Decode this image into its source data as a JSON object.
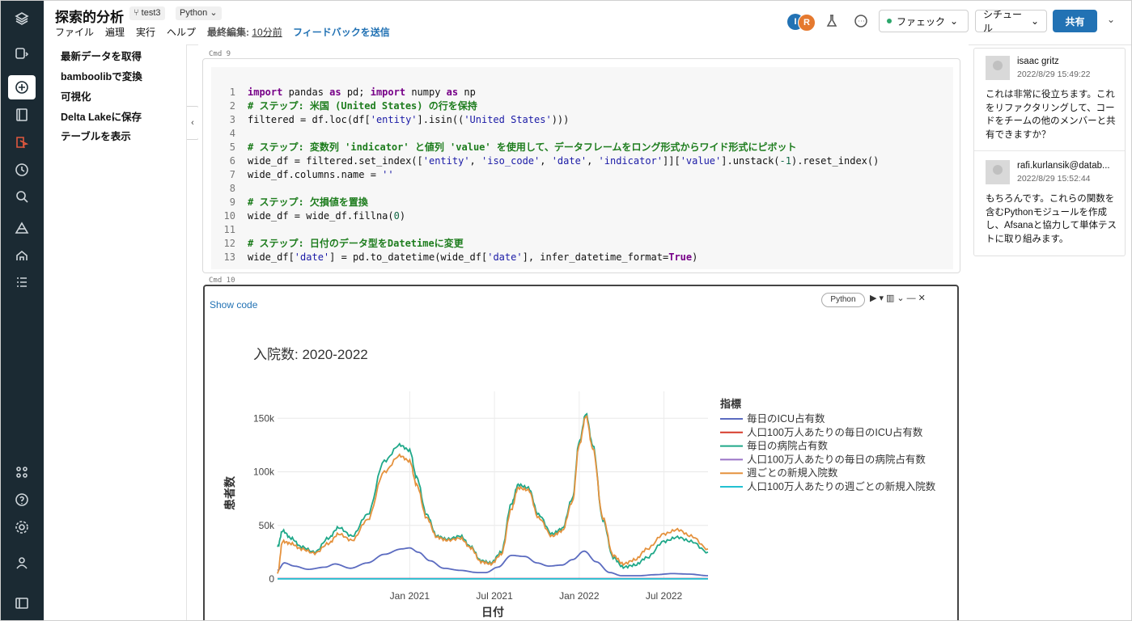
{
  "header": {
    "title": "探索的分析",
    "repo_chip": "test3",
    "lang_chip": "Python",
    "menu": [
      "ファイル",
      "遍理",
      "実行",
      "ヘルプ"
    ],
    "edited_label": "最終編集:",
    "edited_value": "10分前",
    "feedback": "フィードバックを送信",
    "avatar1": "I",
    "avatar2": "R",
    "compute_btn": "ファェック",
    "schedule_btn": "シチュール",
    "share_btn": "共有"
  },
  "toc": [
    "最新データを取得",
    "bamboolibで変換",
    "可視化",
    "Delta Lakeに保存",
    "テーブルを表示"
  ],
  "cells": {
    "cmd9": "Cmd 9",
    "cmd10": "Cmd 10",
    "show_code": "Show code",
    "py_chip": "Python"
  },
  "code_lines": [
    "import pandas as pd; import numpy as np",
    "# ステップ: 米国 (United States) の行を保持",
    "filtered = df.loc(df['entity'].isin(('United States')))",
    "",
    "# ステップ: 変数列 'indicator' と値列 'value' を使用して、データフレームをロング形式からワイド形式にピボット",
    "wide_df = filtered.set_index(['entity', 'iso_code', 'date', 'indicator']]['value'].unstack(-1).reset_index()",
    "wide_df.columns.name = ''",
    "",
    "# ステップ: 欠損値を置換",
    "wide_df = wide_df.fillna(0)",
    "",
    "# ステップ: 日付のデータ型をDatetimeに変更",
    "wide_df['date'] = pd.to_datetime(wide_df['date'], infer_datetime_format=True)"
  ],
  "comments": [
    {
      "name": "isaac gritz",
      "time": "2022/8/29 15:49:22",
      "body": "これは非常に役立ちます。これをリファクタリングして、コードをチームの他のメンバーと共有できますか？"
    },
    {
      "name": "rafi.kurlansik@datab...",
      "time": "2022/8/29 15:52:44",
      "body": "もちろんです。これらの関数を含むPythonモジュールを作成し、Afsanaと協力して単体テストに取り組みます。"
    }
  ],
  "chart_data": {
    "type": "line",
    "title": "入院数: 2020-2022",
    "xlabel": "日付",
    "ylabel": "患者数",
    "ylim": [
      0,
      160000
    ],
    "yticks": [
      {
        "v": 0,
        "label": "0"
      },
      {
        "v": 50000,
        "label": "50k"
      },
      {
        "v": 100000,
        "label": "100k"
      },
      {
        "v": 150000,
        "label": "150k"
      }
    ],
    "xticks": [
      {
        "v": 2021.0,
        "label": "Jan 2021"
      },
      {
        "v": 2021.5,
        "label": "Jul 2021"
      },
      {
        "v": 2022.0,
        "label": "Jan 2022"
      },
      {
        "v": 2022.5,
        "label": "Jul 2022"
      }
    ],
    "xlim": [
      2020.22,
      2022.76
    ],
    "legend_title": "指標",
    "legend_position": "right",
    "series": [
      {
        "name": "毎日のICU占有数",
        "color": "#5b6bc0",
        "x": [
          2020.22,
          2020.26,
          2020.32,
          2020.4,
          2020.5,
          2020.56,
          2020.65,
          2020.75,
          2020.85,
          2020.95,
          2021.0,
          2021.05,
          2021.12,
          2021.2,
          2021.3,
          2021.4,
          2021.45,
          2021.52,
          2021.6,
          2021.68,
          2021.75,
          2021.82,
          2021.9,
          2021.96,
          2022.03,
          2022.1,
          2022.18,
          2022.25,
          2022.35,
          2022.45,
          2022.55,
          2022.65,
          2022.76
        ],
        "values": [
          8000,
          15000,
          12000,
          9000,
          11000,
          14000,
          10000,
          15000,
          23000,
          28000,
          29000,
          25000,
          17000,
          10000,
          8000,
          6000,
          6000,
          11000,
          22000,
          21000,
          15000,
          12000,
          13000,
          18000,
          26000,
          16000,
          6000,
          3000,
          3000,
          4000,
          5000,
          4500,
          3000
        ]
      },
      {
        "name": "人口100万人あたりの毎日のICU占有数",
        "color": "#d63a2a",
        "x": [
          2020.22,
          2022.76
        ],
        "values": [
          300,
          300
        ]
      },
      {
        "name": "毎日の病院占有数",
        "color": "#1fa889",
        "x": [
          2020.22,
          2020.25,
          2020.3,
          2020.36,
          2020.44,
          2020.52,
          2020.58,
          2020.66,
          2020.75,
          2020.85,
          2020.94,
          2021.0,
          2021.04,
          2021.1,
          2021.16,
          2021.22,
          2021.3,
          2021.36,
          2021.42,
          2021.48,
          2021.54,
          2021.6,
          2021.64,
          2021.7,
          2021.76,
          2021.84,
          2021.9,
          2021.96,
          2022.0,
          2022.04,
          2022.08,
          2022.14,
          2022.2,
          2022.26,
          2022.33,
          2022.4,
          2022.5,
          2022.58,
          2022.66,
          2022.76
        ],
        "values": [
          30000,
          45000,
          38000,
          30000,
          25000,
          38000,
          48000,
          40000,
          60000,
          110000,
          125000,
          120000,
          95000,
          60000,
          40000,
          37000,
          40000,
          30000,
          17000,
          15000,
          25000,
          70000,
          88000,
          85000,
          60000,
          42000,
          47000,
          75000,
          128000,
          154000,
          125000,
          55000,
          20000,
          11000,
          13000,
          20000,
          35000,
          39000,
          35000,
          25000
        ]
      },
      {
        "name": "人口100万人あたりの毎日の病院占有数",
        "color": "#9a73c6",
        "x": [
          2020.22,
          2022.76
        ],
        "values": [
          200,
          200
        ]
      },
      {
        "name": "週ごとの新規入院数",
        "color": "#e5923e",
        "x": [
          2020.22,
          2020.25,
          2020.3,
          2020.36,
          2020.44,
          2020.52,
          2020.58,
          2020.66,
          2020.75,
          2020.85,
          2020.94,
          2021.0,
          2021.04,
          2021.1,
          2021.16,
          2021.22,
          2021.3,
          2021.36,
          2021.42,
          2021.48,
          2021.54,
          2021.6,
          2021.64,
          2021.7,
          2021.76,
          2021.84,
          2021.9,
          2021.96,
          2022.0,
          2022.04,
          2022.08,
          2022.14,
          2022.2,
          2022.26,
          2022.33,
          2022.4,
          2022.5,
          2022.58,
          2022.66,
          2022.76
        ],
        "values": [
          5000,
          35000,
          33000,
          28000,
          24000,
          33000,
          42000,
          36000,
          55000,
          100000,
          115000,
          110000,
          88000,
          57000,
          39000,
          36000,
          38000,
          29000,
          16000,
          14000,
          23000,
          65000,
          85000,
          83000,
          57000,
          40000,
          45000,
          72000,
          125000,
          152000,
          122000,
          57000,
          22000,
          14000,
          18000,
          28000,
          42000,
          46000,
          40000,
          28000
        ]
      },
      {
        "name": "人口100万人あたりの週ごとの新規入院数",
        "color": "#22c1d1",
        "x": [
          2020.22,
          2022.76
        ],
        "values": [
          100,
          100
        ]
      }
    ]
  }
}
